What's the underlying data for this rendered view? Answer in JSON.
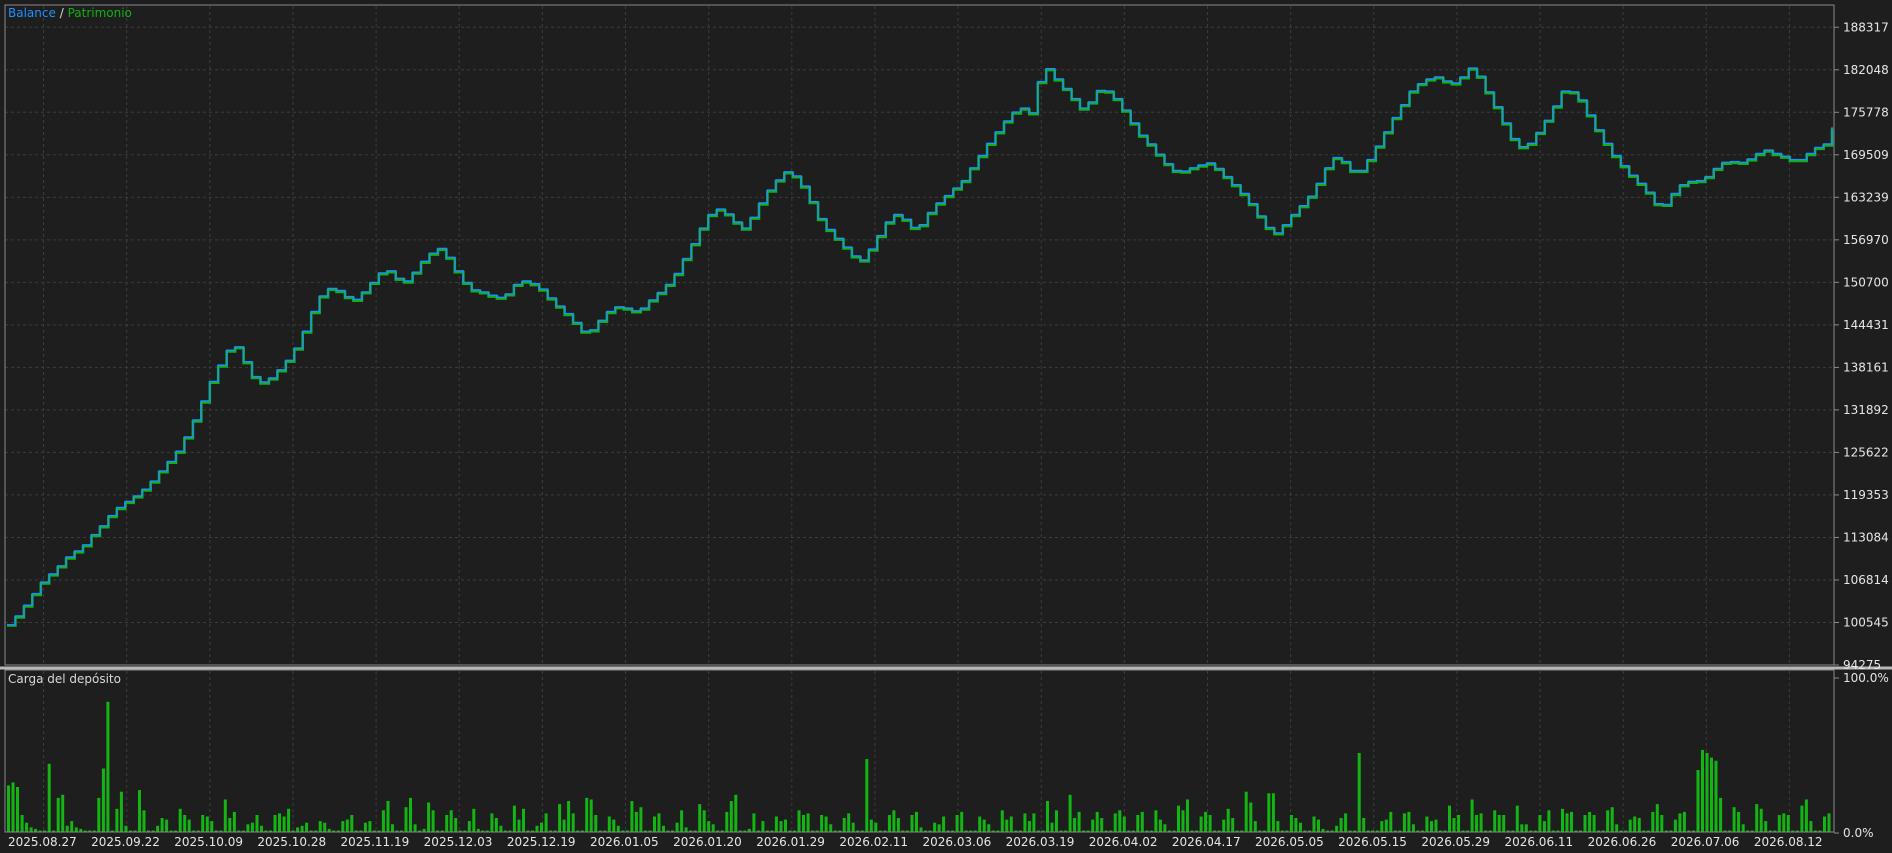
{
  "colors": {
    "background": "#1e1e1e",
    "grid": "#3c3c3c",
    "frame": "#8a8a8a",
    "balance": "#1e90ff",
    "equity": "#13b013",
    "load_bars": "#13b513"
  },
  "legend": {
    "balance_label": "Balance",
    "separator": "/",
    "equity_label": "Patrimonio"
  },
  "chart_data": [
    {
      "type": "line",
      "series": [
        {
          "name": "Balance",
          "values": [
            100200,
            101500,
            103100,
            104800,
            106500,
            107700,
            108900,
            110200,
            111100,
            112000,
            113500,
            114800,
            116300,
            117500,
            118400,
            119200,
            120200,
            121400,
            122900,
            124300,
            125800,
            127900,
            130400,
            133200,
            136100,
            138500,
            140700,
            141200,
            139000,
            136800,
            136000,
            136600,
            137800,
            139200,
            141000,
            143500,
            146400,
            148700,
            149800,
            149500,
            148600,
            148200,
            149300,
            150700,
            152100,
            152400,
            151300,
            150900,
            152200,
            153800,
            155000,
            155700,
            154400,
            152400,
            150700,
            149600,
            149300,
            148800,
            148500,
            149000,
            150400,
            150900,
            150500,
            149700,
            148400,
            147200,
            146100,
            144800,
            143500,
            143700,
            145100,
            146400,
            147100,
            146900,
            146500,
            146900,
            148100,
            149200,
            150400,
            152000,
            154200,
            156400,
            158700,
            160700,
            161500,
            160800,
            159600,
            158700,
            160300,
            162400,
            164300,
            165800,
            167000,
            166400,
            164900,
            162600,
            160100,
            158500,
            157200,
            155900,
            154600,
            154000,
            155600,
            157600,
            159600,
            160700,
            160000,
            158800,
            159200,
            161000,
            162400,
            163500,
            164600,
            165700,
            167600,
            169400,
            171200,
            172900,
            174500,
            175800,
            176400,
            175700,
            180300,
            182200,
            180700,
            179300,
            177800,
            176400,
            177300,
            179000,
            178900,
            177800,
            176100,
            174200,
            172400,
            171100,
            169600,
            168200,
            167200,
            167100,
            167600,
            168000,
            168300,
            167500,
            166300,
            165100,
            163800,
            162300,
            160500,
            158800,
            158000,
            159200,
            160700,
            162000,
            163400,
            165300,
            167600,
            169100,
            168500,
            167200,
            167200,
            168800,
            170800,
            172900,
            175000,
            176900,
            178900,
            180000,
            180700,
            181000,
            180400,
            180100,
            181000,
            182300,
            181100,
            178800,
            176600,
            174200,
            171900,
            170700,
            171200,
            172800,
            174600,
            176700,
            178900,
            178800,
            177600,
            175400,
            173200,
            171200,
            169400,
            167900,
            166500,
            165300,
            164000,
            162300,
            162200,
            163800,
            165100,
            165600,
            165700,
            166300,
            167500,
            168400,
            168500,
            168400,
            168900,
            169700,
            170200,
            169700,
            169300,
            168800,
            168800,
            169700,
            170600,
            171100,
            173600
          ]
        },
        {
          "name": "Patrimonio",
          "values": [
            100100,
            101300,
            102900,
            104600,
            106300,
            107500,
            108700,
            110000,
            110900,
            111800,
            113300,
            114600,
            116100,
            117300,
            118200,
            119000,
            120000,
            121200,
            122700,
            124100,
            125600,
            127700,
            130200,
            133000,
            135900,
            138300,
            140500,
            141000,
            138800,
            136600,
            135800,
            136400,
            137600,
            139000,
            140800,
            143300,
            146200,
            148500,
            149600,
            149300,
            148400,
            148000,
            149100,
            150500,
            151900,
            152200,
            151100,
            150700,
            152000,
            153600,
            154800,
            155500,
            154200,
            152200,
            150500,
            149400,
            149100,
            148600,
            148300,
            148800,
            150200,
            150700,
            150300,
            149500,
            148200,
            147000,
            145900,
            144600,
            143300,
            143500,
            144900,
            146200,
            146900,
            146700,
            146300,
            146700,
            147900,
            149000,
            150200,
            151800,
            154000,
            156200,
            158500,
            160500,
            161300,
            160600,
            159400,
            158500,
            160100,
            162200,
            164100,
            165600,
            166800,
            166200,
            164700,
            162400,
            159900,
            158300,
            157000,
            155700,
            154400,
            153800,
            155400,
            157400,
            159400,
            160500,
            159800,
            158600,
            159000,
            160800,
            162200,
            163300,
            164400,
            165500,
            167400,
            169200,
            171000,
            172700,
            174300,
            175600,
            176200,
            175500,
            180100,
            182000,
            180500,
            179100,
            177600,
            176200,
            177100,
            178800,
            178700,
            177600,
            175900,
            174000,
            172200,
            170900,
            169400,
            168000,
            167000,
            166900,
            167400,
            167800,
            168100,
            167300,
            166100,
            164900,
            163600,
            162100,
            160300,
            158600,
            157800,
            159000,
            160500,
            161800,
            163200,
            165100,
            167400,
            168900,
            168300,
            167000,
            167000,
            168600,
            170600,
            172700,
            174800,
            176700,
            178700,
            179800,
            180500,
            180800,
            180200,
            179900,
            180800,
            182100,
            180900,
            178600,
            176400,
            174000,
            171700,
            170500,
            171000,
            172600,
            174400,
            176500,
            178700,
            178600,
            177400,
            175200,
            173000,
            171000,
            169200,
            167700,
            166300,
            165100,
            163800,
            162100,
            162000,
            163600,
            164900,
            165400,
            165500,
            166100,
            167300,
            168200,
            168300,
            168200,
            168700,
            169500,
            170000,
            169500,
            169100,
            168600,
            168600,
            169500,
            170400,
            170900,
            173400
          ]
        }
      ],
      "y_ticks": [
        "188317",
        "182048",
        "175778",
        "169509",
        "163239",
        "156970",
        "150700",
        "144431",
        "138161",
        "131892",
        "125622",
        "119353",
        "113084",
        "106814",
        "100545",
        "94275"
      ],
      "ylim": [
        94275,
        191452
      ],
      "grid": true,
      "legend": "top-left"
    },
    {
      "type": "bar",
      "title": "Carga del depósito",
      "y_ticks": [
        "100.0%",
        "0.0%"
      ],
      "ylim": [
        0,
        100
      ],
      "values": [
        30,
        32,
        29,
        11,
        6,
        3,
        2,
        1,
        1,
        44,
        1,
        22,
        24,
        4,
        7,
        3,
        2,
        1,
        1,
        1,
        22,
        41,
        84,
        1,
        15,
        26,
        4,
        1,
        1,
        27,
        14,
        1,
        1,
        4,
        9,
        8,
        1,
        1,
        15,
        11,
        8,
        1,
        1,
        11,
        10,
        7,
        1,
        1,
        21,
        9,
        13,
        1,
        1,
        5,
        6,
        11,
        4,
        1,
        1,
        11,
        12,
        10,
        15,
        1,
        3,
        4,
        6,
        1,
        1,
        7,
        6,
        2,
        1,
        1,
        7,
        8,
        11,
        1,
        1,
        6,
        7,
        1,
        1,
        14,
        20,
        5,
        1,
        1,
        16,
        22,
        5,
        1,
        2,
        19,
        14,
        1,
        1,
        11,
        14,
        9,
        1,
        1,
        7,
        15,
        2,
        1,
        1,
        12,
        9,
        4,
        1,
        1,
        17,
        8,
        15,
        1,
        1,
        4,
        6,
        12,
        1,
        1,
        18,
        8,
        20,
        12,
        1,
        1,
        22,
        21,
        11,
        1,
        1,
        10,
        8,
        4,
        1,
        1,
        20,
        13,
        16,
        1,
        1,
        10,
        12,
        4,
        1,
        1,
        6,
        14,
        3,
        1,
        1,
        18,
        14,
        7,
        5,
        1,
        1,
        13,
        20,
        24,
        1,
        1,
        2,
        12,
        1,
        7,
        1,
        1,
        10,
        7,
        8,
        1,
        1,
        14,
        11,
        12,
        1,
        1,
        11,
        10,
        5,
        1,
        1,
        9,
        12,
        6,
        1,
        1,
        47,
        8,
        6,
        1,
        1,
        11,
        14,
        9,
        1,
        1,
        11,
        13,
        3,
        1,
        1,
        6,
        5,
        10,
        1,
        1,
        11,
        13,
        1,
        1,
        1,
        10,
        8,
        5,
        1,
        1,
        14,
        8,
        10,
        1,
        1,
        12,
        7,
        12,
        1,
        1,
        20,
        6,
        14,
        1,
        1,
        24,
        9,
        13,
        1,
        1,
        8,
        13,
        9,
        1,
        1,
        12,
        14,
        10,
        1,
        1,
        11,
        13,
        1,
        1,
        14,
        8,
        5,
        1,
        1,
        17,
        14,
        21,
        1,
        1,
        10,
        13,
        11,
        1,
        1,
        8,
        15,
        9,
        1,
        1,
        26,
        19,
        7,
        1,
        1,
        25,
        25,
        7,
        1,
        1,
        11,
        9,
        6,
        1,
        1,
        10,
        8,
        2,
        1,
        1,
        4,
        9,
        12,
        1,
        1,
        51,
        9,
        1,
        1,
        1,
        7,
        8,
        13,
        1,
        1,
        12,
        13,
        5,
        1,
        1,
        10,
        7,
        8,
        1,
        1,
        17,
        9,
        11,
        1,
        1,
        21,
        11,
        12,
        1,
        1,
        14,
        11,
        11,
        1,
        1,
        17,
        5,
        5,
        1,
        1,
        11,
        7,
        14,
        1,
        1,
        15,
        12,
        13,
        1,
        1,
        11,
        13,
        11,
        1,
        1,
        14,
        16,
        5,
        1,
        1,
        8,
        10,
        9,
        1,
        1,
        13,
        18,
        11,
        1,
        1,
        8,
        12,
        13,
        1,
        1,
        40,
        53,
        51,
        48,
        46,
        22,
        1,
        1,
        16,
        13,
        5,
        1,
        1,
        18,
        15,
        7,
        1,
        1,
        11,
        12,
        11,
        1,
        1,
        17,
        21,
        7,
        1,
        1,
        10,
        12
      ]
    }
  ],
  "x_axis": {
    "date_labels": [
      "2025.08.27",
      "2025.09.22",
      "2025.10.09",
      "2025.10.28",
      "2025.11.19",
      "2025.12.03",
      "2025.12.19",
      "2026.01.05",
      "2026.01.20",
      "2026.01.29",
      "2026.02.11",
      "2026.03.06",
      "2026.03.19",
      "2026.04.02",
      "2026.04.17",
      "2026.05.05",
      "2026.05.15",
      "2026.05.29",
      "2026.06.11",
      "2026.06.26",
      "2026.07.06",
      "2026.08.12"
    ]
  }
}
